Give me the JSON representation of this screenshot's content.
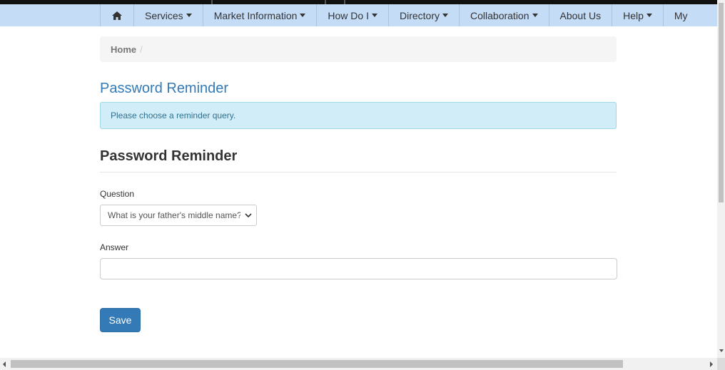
{
  "nav": {
    "home_icon": "home-icon",
    "items": [
      {
        "label": "Services",
        "dropdown": true
      },
      {
        "label": "Market Information",
        "dropdown": true
      },
      {
        "label": "How Do I",
        "dropdown": true
      },
      {
        "label": "Directory",
        "dropdown": true
      },
      {
        "label": "Collaboration",
        "dropdown": true
      },
      {
        "label": "About Us",
        "dropdown": false
      },
      {
        "label": "Help",
        "dropdown": true
      },
      {
        "label": "My",
        "dropdown": false
      }
    ],
    "background_color": "#c5dcf7"
  },
  "breadcrumb": {
    "items": [
      "Home"
    ],
    "separator": "/"
  },
  "page": {
    "title": "Password Reminder",
    "alert": "Please choose a reminder query.",
    "section_title": "Password Reminder"
  },
  "form": {
    "question_label": "Question",
    "question_value": "What is your father's middle name?",
    "answer_label": "Answer",
    "answer_value": "",
    "save_label": "Save"
  },
  "colors": {
    "accent": "#337ab7",
    "alert_background": "#d0edf8",
    "alert_text": "#31708f"
  }
}
